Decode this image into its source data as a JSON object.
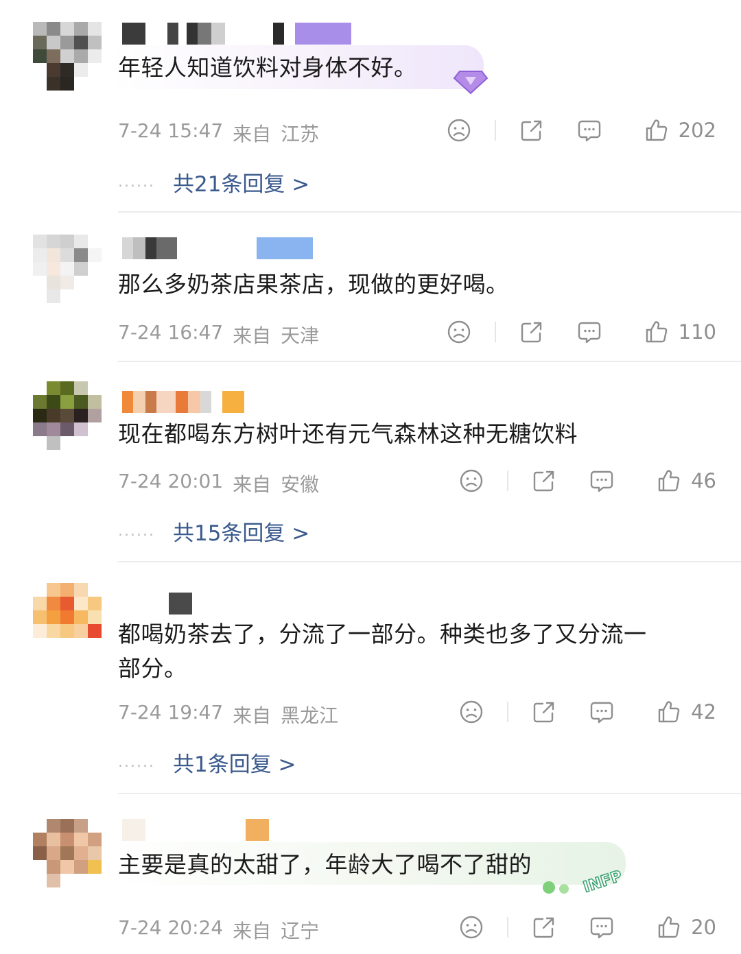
{
  "comments": [
    {
      "text": "年轻人知道饮料对身体不好。",
      "time": "7-24 15:47",
      "from": "来自",
      "location": "江苏",
      "likes": "202",
      "replies": "共21条回复 >"
    },
    {
      "text": "那么多奶茶店果茶店，现做的更好喝。",
      "time": "7-24 16:47",
      "from": "来自",
      "location": "天津",
      "likes": "110",
      "replies": ""
    },
    {
      "text": "现在都喝东方树叶还有元气森林这种无糖饮料",
      "time": "7-24 20:01",
      "from": "来自",
      "location": "安徽",
      "likes": "46",
      "replies": "共15条回复 >"
    },
    {
      "text": "都喝奶茶去了，分流了一部分。种类也多了又分流一\n部分。",
      "time": "7-24 19:47",
      "from": "来自",
      "location": "黑龙江",
      "likes": "42",
      "replies": "共1条回复 >"
    },
    {
      "text": "主要是真的太甜了，年龄大了喝不了甜的",
      "time": "7-24 20:24",
      "from": "来自",
      "location": "辽宁",
      "likes": "20",
      "replies": ""
    }
  ],
  "icons": {
    "dislike": "sad-face-icon",
    "share": "share-icon",
    "comment": "comment-icon",
    "like": "thumbs-up-icon"
  },
  "badge_text": "INFP",
  "dots": "......",
  "colors": {
    "reply_link": "#3a5a8c",
    "meta": "#9a9a9a",
    "divider": "#ececec"
  }
}
